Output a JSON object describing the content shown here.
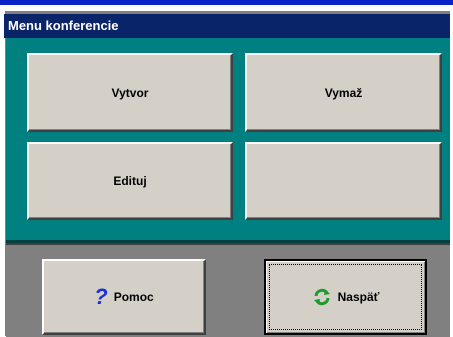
{
  "window": {
    "title": "Menu konferencie"
  },
  "menu": {
    "create_label": "Vytvor",
    "delete_label": "Vymaž",
    "edit_label": "Edituj",
    "empty_label": ""
  },
  "footer": {
    "help_label": "Pomoc",
    "back_label": "Naspäť"
  },
  "icons": {
    "help": "question-mark-icon",
    "back": "refresh-arrows-icon"
  },
  "colors": {
    "title_bar": "#0a246a",
    "panel": "#008080",
    "button_face": "#d4d0c8",
    "help_icon": "#1a2fd8",
    "back_icon": "#1c9a2a"
  }
}
